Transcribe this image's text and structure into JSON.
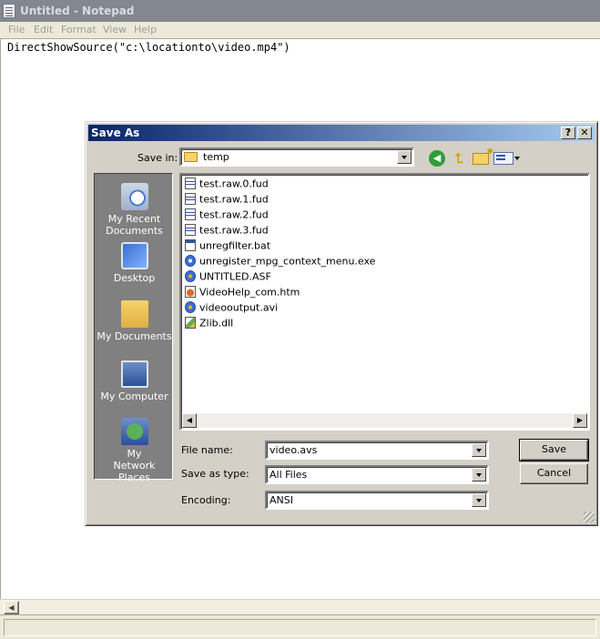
{
  "notepad": {
    "title": "Untitled - Notepad",
    "menu": [
      "File",
      "Edit",
      "Format",
      "View",
      "Help"
    ],
    "content": "DirectShowSource(\"c:\\locationto\\video.mp4\")"
  },
  "dialog": {
    "title": "Save As",
    "help_button": "?",
    "close_button": "✕",
    "save_in_label": "Save in:",
    "save_in_value": "temp",
    "places": [
      {
        "label": "My Recent Documents",
        "icon": "recent-documents-icon"
      },
      {
        "label": "Desktop",
        "icon": "desktop-icon"
      },
      {
        "label": "My Documents",
        "icon": "my-documents-icon"
      },
      {
        "label": "My Computer",
        "icon": "my-computer-icon"
      },
      {
        "label": "My Network Places",
        "icon": "my-network-places-icon"
      }
    ],
    "files": [
      {
        "name": "test.raw.0.fud",
        "icon": "fud-file-icon"
      },
      {
        "name": "test.raw.1.fud",
        "icon": "fud-file-icon"
      },
      {
        "name": "test.raw.2.fud",
        "icon": "fud-file-icon"
      },
      {
        "name": "test.raw.3.fud",
        "icon": "fud-file-icon"
      },
      {
        "name": "unregfilter.bat",
        "icon": "batch-file-icon"
      },
      {
        "name": "unregister_mpg_context_menu.exe",
        "icon": "exe-file-icon"
      },
      {
        "name": "UNTITLED.ASF",
        "icon": "media-file-icon"
      },
      {
        "name": "VideoHelp_com.htm",
        "icon": "html-file-icon"
      },
      {
        "name": "videooutput.avi",
        "icon": "media-file-icon"
      },
      {
        "name": "Zlib.dll",
        "icon": "dll-file-icon"
      }
    ],
    "file_name_label": "File name:",
    "file_name_value": "video.avs",
    "save_as_type_label": "Save as type:",
    "save_as_type_value": "All Files",
    "encoding_label": "Encoding:",
    "encoding_value": "ANSI",
    "save_button": "Save",
    "cancel_button": "Cancel"
  },
  "colors": {
    "dialog_title_start": "#0a246a",
    "dialog_title_end": "#a6caf0",
    "places_bar": "#808080",
    "notepad_title_inactive": "#828790"
  }
}
